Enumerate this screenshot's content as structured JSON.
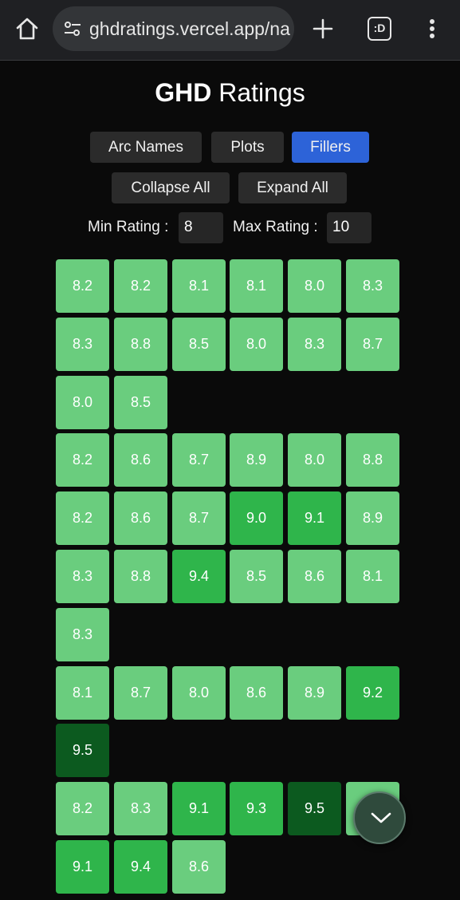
{
  "browser": {
    "url": "ghdratings.vercel.app/na",
    "tab_icon_text": ":D"
  },
  "page": {
    "title_bold": "GHD",
    "title_rest": " Ratings"
  },
  "buttons": {
    "arc_names": "Arc Names",
    "plots": "Plots",
    "fillers": "Fillers",
    "collapse_all": "Collapse All",
    "expand_all": "Expand All"
  },
  "filters": {
    "min_label": "Min Rating :",
    "min_value": "8",
    "max_label": "Max Rating :",
    "max_value": "10"
  },
  "colors": {
    "light": "#6acd7e",
    "medium": "#2fb54b",
    "dark": "#0c5a1f",
    "active_button": "#2d63d8"
  },
  "rows": [
    [
      "8.2",
      "8.2",
      "8.1",
      "8.1",
      "8.0",
      "8.3"
    ],
    [
      "8.3",
      "8.8",
      "8.5",
      "8.0",
      "8.3",
      "8.7"
    ],
    [
      "8.0",
      "8.5"
    ],
    [
      "8.2",
      "8.6",
      "8.7",
      "8.9",
      "8.0",
      "8.8"
    ],
    [
      "8.2",
      "8.6",
      "8.7",
      "9.0",
      "9.1",
      "8.9"
    ],
    [
      "8.3",
      "8.8",
      "9.4",
      "8.5",
      "8.6",
      "8.1"
    ],
    [
      "8.3"
    ],
    [
      "8.1",
      "8.7",
      "8.0",
      "8.6",
      "8.9",
      "9.2"
    ],
    [
      "9.5"
    ],
    [
      "8.2",
      "8.3",
      "9.1",
      "9.3",
      "9.5",
      ""
    ],
    [
      "9.1",
      "9.4",
      "8.6"
    ]
  ]
}
